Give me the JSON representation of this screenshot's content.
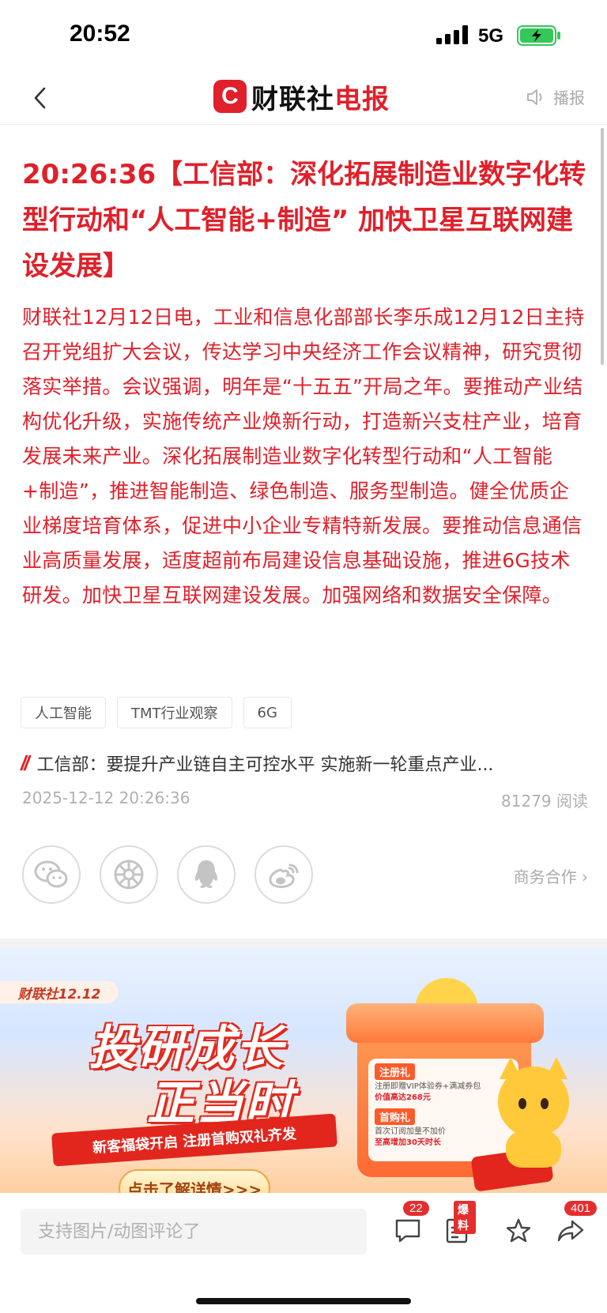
{
  "status_bar": {
    "time": "20:52",
    "network": "5G"
  },
  "nav": {
    "logo_letter": "C",
    "logo_text_a": "财联社",
    "logo_text_b": "电报",
    "broadcast_label": "播报"
  },
  "article": {
    "headline": "20:26:36【工信部：深化拓展制造业数字化转型行动和“人工智能+制造” 加快卫星互联网建设发展】",
    "body": "财联社12月12日电，工业和信息化部部长李乐成12月12日主持召开党组扩大会议，传达学习中央经济工作会议精神，研究贯彻落实举措。会议强调，明年是“十五五”开局之年。要推动产业结构优化升级，实施传统产业焕新行动，打造新兴支柱产业，培育发展未来产业。深化拓展制造业数字化转型行动和“人工智能+制造”，推进智能制造、绿色制造、服务型制造。健全优质企业梯度培育体系，促进中小企业专精特新发展。要推动信息通信业高质量发展，适度超前布局建设信息基础设施，推进6G技术研发。加快卫星互联网建设发展。加强网络和数据安全保障。",
    "tags": [
      "人工智能",
      "TMT行业观察",
      "6G"
    ],
    "related_title": "工信部：要提升产业链自主可控水平 实施新一轮重点产业...",
    "datetime": "2025-12-12 20:26:36",
    "reads": "81279 阅读"
  },
  "share": {
    "icons": [
      "wechat-icon",
      "moments-icon",
      "qq-icon",
      "weibo-icon"
    ],
    "business_label": "商务合作 ›"
  },
  "banner": {
    "tag": "财联社12.12",
    "title_line1": "投研成长",
    "title_line2": "正当时",
    "ribbon": "新客福袋开启 注册首购双礼齐发",
    "cta": "点击了解详情>>>",
    "gift1_title": "注册礼",
    "gift1_line1": "注册即赠VIP体验券+满减券包",
    "gift1_line2": "价值高达268元",
    "gift2_title": "首购礼",
    "gift2_line1": "首次订阅加量不加价",
    "gift2_line2": "至高增加30天时长"
  },
  "bottom": {
    "comment_placeholder": "支持图片/动图评论了",
    "comment_count": "22",
    "report_label": "爆料",
    "share_count": "401"
  },
  "colors": {
    "accent_red": "#e0202a",
    "text_gray": "#b0b0b0",
    "battery_green": "#34c759"
  }
}
